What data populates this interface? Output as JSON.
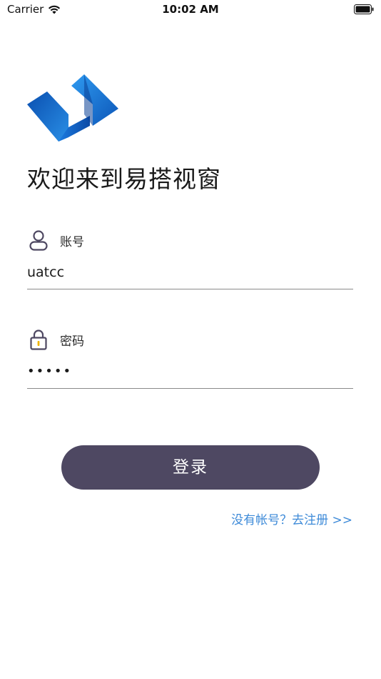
{
  "status_bar": {
    "carrier": "Carrier",
    "time": "10:02 AM"
  },
  "welcome": {
    "title": "欢迎来到易搭视窗"
  },
  "account": {
    "label": "账号",
    "value": "uatcc",
    "icon": "user-icon"
  },
  "password": {
    "label": "密码",
    "value": "•••••",
    "icon": "lock-icon"
  },
  "actions": {
    "login_label": "登录",
    "register_link": "没有帐号？去注册 >>"
  },
  "colors": {
    "button": "#4e4862",
    "link": "#3d8ad8",
    "logo_blue": "#1565c8"
  }
}
